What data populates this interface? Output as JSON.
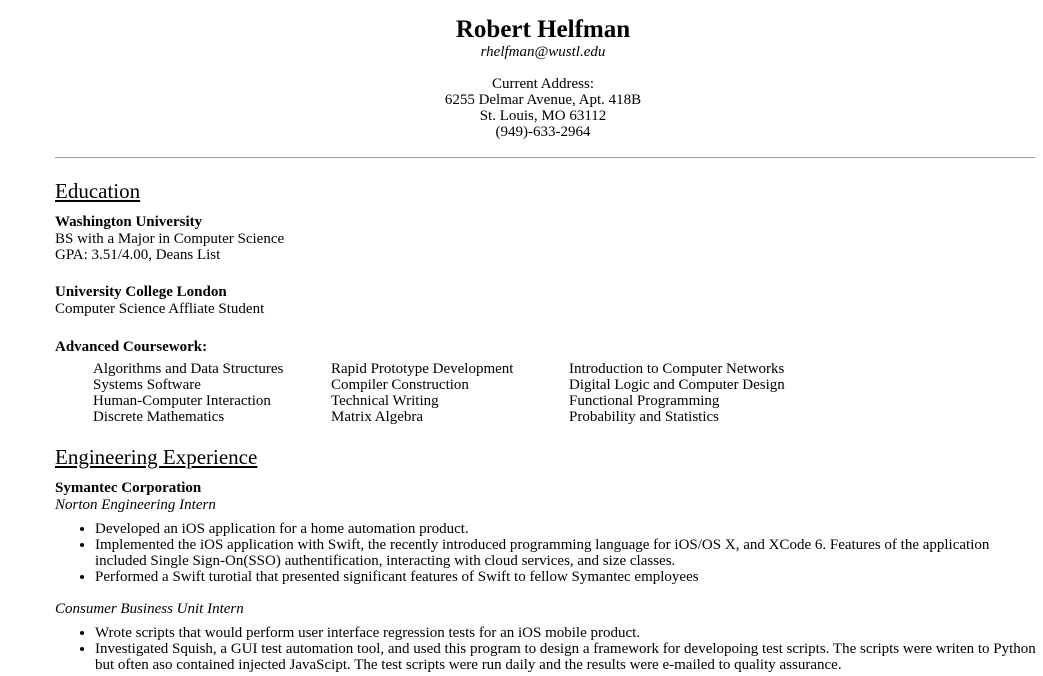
{
  "header": {
    "name": "Robert Helfman",
    "email": "rhelfman@wustl.edu",
    "address_label": "Current Address:",
    "street": "6255 Delmar Avenue, Apt. 418B",
    "city": "St. Louis, MO 63112",
    "phone": "(949)-633-2964"
  },
  "education": {
    "heading": "Education",
    "schools": [
      {
        "name": "Washington University",
        "lines": [
          "BS with a Major in Computer Science",
          "GPA: 3.51/4.00, Deans List"
        ]
      },
      {
        "name": "University College London",
        "lines": [
          "Computer Science Affliate Student"
        ]
      }
    ],
    "coursework_heading": "Advanced Coursework:",
    "coursework_columns": [
      [
        "Algorithms and Data Structures",
        "Systems Software",
        "Human-Computer Interaction",
        "Discrete Mathematics"
      ],
      [
        "Rapid Prototype Development",
        "Compiler Construction",
        "Technical Writing",
        "Matrix Algebra"
      ],
      [
        "Introduction to Computer Networks",
        "Digital Logic and Computer Design",
        "Functional Programming",
        "Probability and Statistics"
      ]
    ]
  },
  "experience": {
    "heading": "Engineering Experience",
    "company": "Symantec Corporation",
    "roles": [
      {
        "title": "Norton Engineering Intern",
        "bullets": [
          "Developed an iOS application for a home automation product.",
          "Implemented the iOS application with Swift, the recently introduced programming language for iOS/OS X, and XCode 6. Features of the application included Single Sign-On(SSO) authentification, interacting with cloud services, and size classes.",
          "Performed a Swift turotial that presented significant features of Swift to fellow Symantec employees"
        ]
      },
      {
        "title": "Consumer Business Unit Intern",
        "bullets": [
          "Wrote scripts that would perform user interface regression tests for an iOS mobile product.",
          "Investigated Squish, a GUI test automation tool, and used this program to design a framework for developoing test scripts. The scripts were writen to Python but often aso contained injected JavaScipt. The test scripts were run daily and the results were e-mailed to quality assurance."
        ]
      }
    ]
  }
}
